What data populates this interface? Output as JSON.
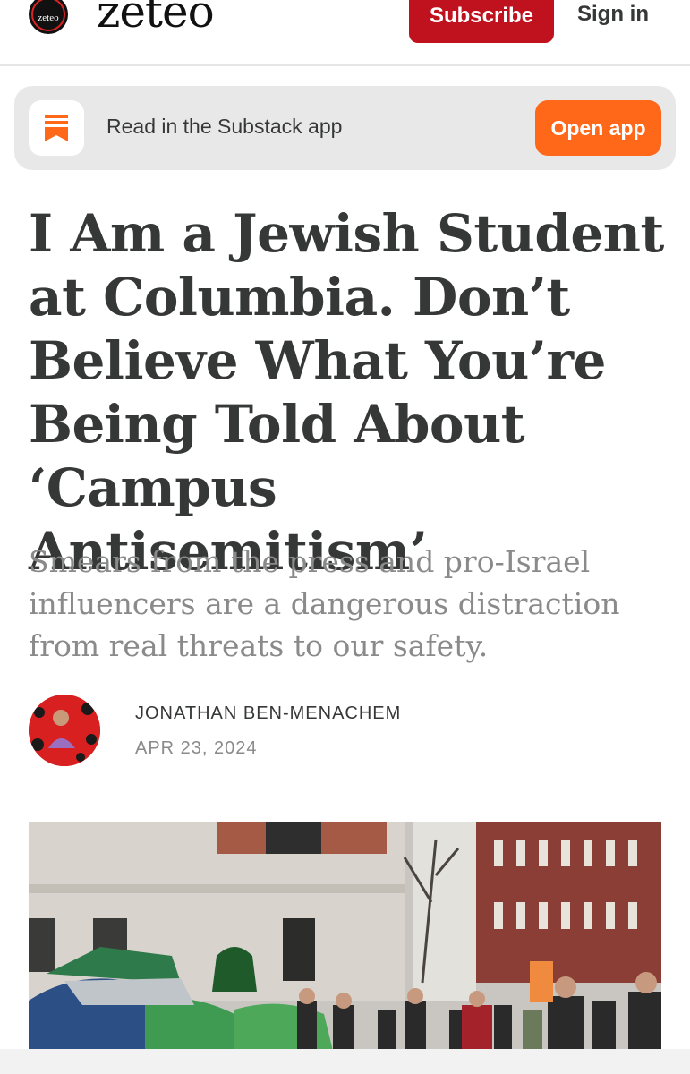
{
  "header": {
    "logo_text": "zeteo",
    "wordmark": "zeteo",
    "subscribe_label": "Subscribe",
    "signin_label": "Sign in"
  },
  "banner": {
    "text": "Read in the Substack app",
    "button_label": "Open app",
    "icon": "substack-icon"
  },
  "article": {
    "title": "I Am a Jewish Student at Columbia. Don’t Believe What You’re Being Told About ‘Campus Antisemitism’",
    "subtitle": "Smears from the press and pro-Israel influencers are a dangerous distraction from real threats to our safety.",
    "author": "JONATHAN BEN-MENACHEM",
    "date": "APR 23, 2024"
  },
  "colors": {
    "subscribe": "#c0121e",
    "open_app": "#ff6719",
    "text": "#363737",
    "muted": "#8a8a8a"
  }
}
